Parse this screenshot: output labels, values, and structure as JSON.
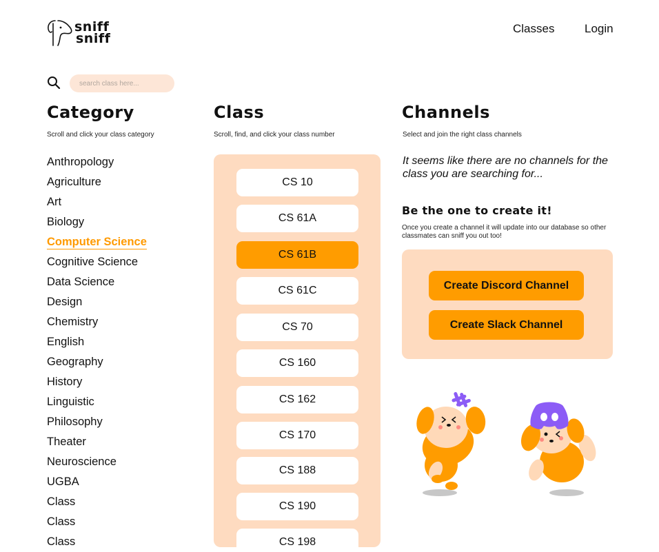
{
  "logo": {
    "line1": "sniff",
    "line2": "sniff"
  },
  "nav": {
    "classes": "Classes",
    "login": "Login"
  },
  "search": {
    "placeholder": "search class here..."
  },
  "category": {
    "title": "Category",
    "subtitle": "Scroll and click your class category",
    "items": [
      "Anthropology",
      "Agriculture",
      "Art",
      "Biology",
      "Computer Science",
      "Cognitive Science",
      "Data Science",
      "Design",
      "Chemistry",
      "English",
      "Geography",
      "History",
      "Linguistic",
      "Philosophy",
      "Theater",
      "Neuroscience",
      "UGBA",
      "Class",
      "Class",
      "Class"
    ],
    "selected": "Computer Science"
  },
  "class": {
    "title": "Class",
    "subtitle": "Scroll, find, and click your class number",
    "items": [
      "CS 10",
      "CS 61A",
      "CS 61B",
      "CS 61C",
      "CS 70",
      "CS 160",
      "CS 162",
      "CS 170",
      "CS 188",
      "CS 190",
      "CS 198"
    ],
    "selected": "CS 61B"
  },
  "channels": {
    "title": "Channels",
    "subtitle": "Select and join the right class channels",
    "empty_message": "It seems like there are no channels for the class you are searching for...",
    "create_title": "Be the one to create it!",
    "create_desc": "Once you create a channel it will update into our database so other classmates can sniff you out too!",
    "discord_button": "Create Discord Channel",
    "slack_button": "Create Slack Channel"
  },
  "colors": {
    "accent": "#ff9c00",
    "panel": "#fedbc0",
    "search_bg": "#fde6d7",
    "discord": "#8c5cf6"
  },
  "icons": {
    "search": "search-icon",
    "slack": "slack-icon",
    "discord": "discord-icon"
  }
}
